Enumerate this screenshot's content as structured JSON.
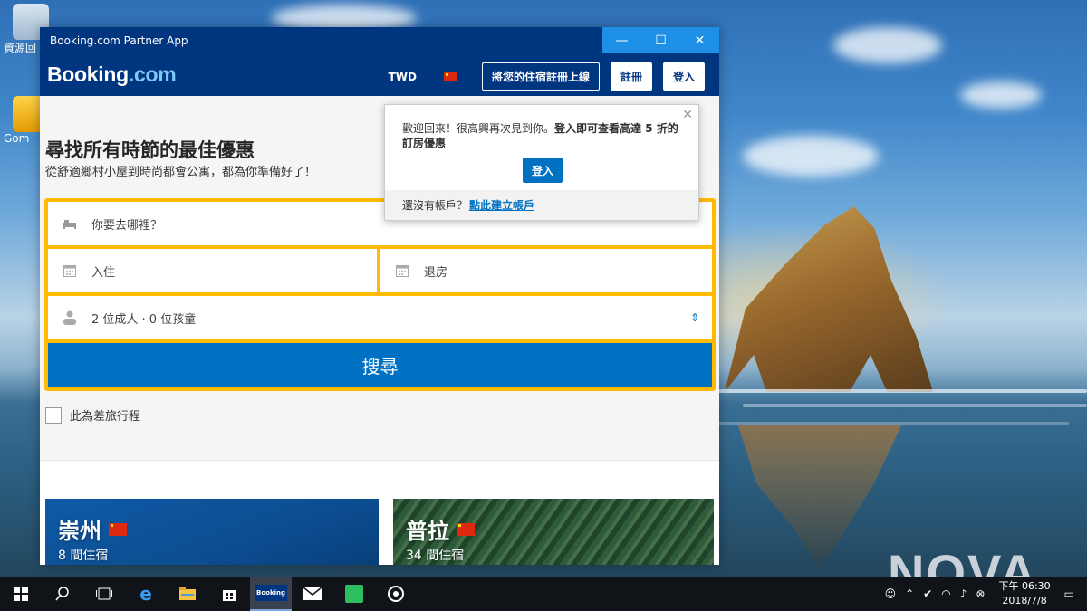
{
  "desktop": {
    "icons": [
      {
        "name": "recycle-bin",
        "label": "資源回"
      },
      {
        "name": "gom",
        "label": "Gom"
      }
    ],
    "watermark": "NOVA"
  },
  "window": {
    "title": "Booking.com Partner App",
    "controls": {
      "minimize": "—",
      "maximize": "☐",
      "close": "✕"
    }
  },
  "header": {
    "logo_main": "Booking",
    "logo_tld": ".com",
    "currency": "TWD",
    "list_property": "將您的住宿註冊上線",
    "register": "註冊",
    "sign_in": "登入"
  },
  "hero": {
    "title": "尋找所有時節的最佳優惠",
    "subtitle": "從舒適鄉村小屋到時尚都會公寓，都為你準備好了！"
  },
  "search": {
    "destination_placeholder": "你要去哪裡？",
    "checkin": "入住",
    "checkout": "退房",
    "guests": "2 位成人 · 0 位孩童",
    "button": "搜尋",
    "business_trip": "此為差旅行程"
  },
  "popup": {
    "message_plain": "歡迎回來！很高興再次見到你。",
    "message_bold": "登入即可查看高達 5 折的訂房優惠",
    "login": "登入",
    "no_account": "還沒有帳戶？",
    "create_account": "點此建立帳戶"
  },
  "destinations": [
    {
      "name": "崇州",
      "count": "8 間住宿"
    },
    {
      "name": "普拉",
      "count": "34 間住宿"
    }
  ],
  "taskbar": {
    "app_label": "Booking",
    "time": "下午 06:30",
    "date": "2018/7/8"
  },
  "colors": {
    "brand_blue": "#003580",
    "action_blue": "#0071c2",
    "search_yellow": "#febb02"
  }
}
